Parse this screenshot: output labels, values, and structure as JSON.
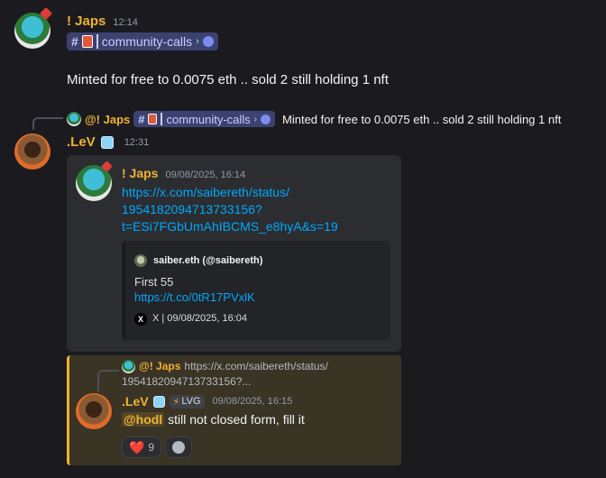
{
  "message1": {
    "author": "! Japs",
    "timestamp": "12:14",
    "channel": "community-calls",
    "text": "Minted for free  to  0.0075  eth .. sold 2 still holding 1 nft"
  },
  "reply_preview": {
    "author": "@! Japs",
    "channel": "community-calls",
    "text": "Minted for free  to  0.0075  eth .. sold 2 still holding 1 nft"
  },
  "message2": {
    "author": ".LeV",
    "timestamp": "12:31",
    "forwarded": {
      "author": "! Japs",
      "timestamp": "09/08/2025, 16:14",
      "link_line1": "https://x.com/saibereth/status/",
      "link_line2": "1954182094713733156?",
      "link_line3": "t=ESi7FGbUmAhIBCMS_e8hyA&s=19",
      "embed": {
        "author": "saiber.eth (@saibereth)",
        "text": "First 55",
        "link": "https://t.co/0tR17PVxlK",
        "footer": "X | 09/08/2025, 16:04"
      }
    }
  },
  "reply_card": {
    "ref_author": "@! Japs",
    "ref_text_line1": "https://x.com/saibereth/status/",
    "ref_text_line2": "1954182094713733156?...",
    "author": ".LeV",
    "badge": "LVG",
    "timestamp": "09/08/2025, 16:15",
    "mention": "@hodl",
    "text": " still not closed form, fill it",
    "reactions": [
      {
        "emoji": "❤️",
        "count": "9"
      }
    ],
    "colors": {
      "accent": "#f0b232",
      "link": "#00a8fc"
    }
  }
}
